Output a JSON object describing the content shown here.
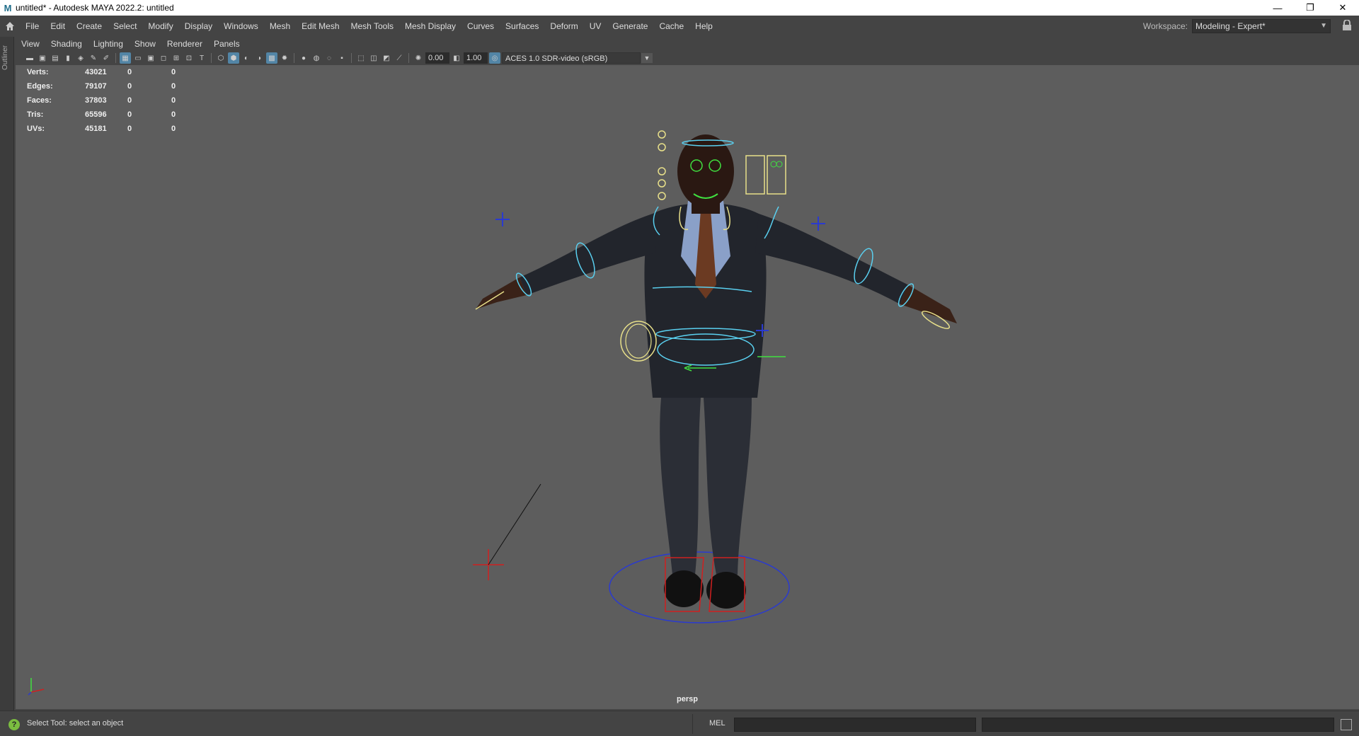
{
  "window": {
    "title": "untitled* - Autodesk MAYA 2022.2: untitled",
    "logo_letter": "M",
    "controls": {
      "minimize": "—",
      "maximize": "❐",
      "close": "✕"
    }
  },
  "menubar": {
    "items": [
      "File",
      "Edit",
      "Create",
      "Select",
      "Modify",
      "Display",
      "Windows",
      "Mesh",
      "Edit Mesh",
      "Mesh Tools",
      "Mesh Display",
      "Curves",
      "Surfaces",
      "Deform",
      "UV",
      "Generate",
      "Cache",
      "Help"
    ],
    "workspace_label": "Workspace:",
    "workspace_value": "Modeling - Expert*",
    "workspace_arrow": "▼"
  },
  "outliner": {
    "label": "Outliner"
  },
  "panel_menu": {
    "items": [
      "View",
      "Shading",
      "Lighting",
      "Show",
      "Renderer",
      "Panels"
    ]
  },
  "panel_toolbar": {
    "exposure": "0.00",
    "gamma": "1.00",
    "color_management": "ACES 1.0 SDR-video (sRGB)",
    "cm_arrow": "▼"
  },
  "hud": {
    "rows": [
      {
        "label": "Verts:",
        "v1": "43021",
        "v2": "0",
        "v3": "0"
      },
      {
        "label": "Edges:",
        "v1": "79107",
        "v2": "0",
        "v3": "0"
      },
      {
        "label": "Faces:",
        "v1": "37803",
        "v2": "0",
        "v3": "0"
      },
      {
        "label": "Tris:",
        "v1": "65596",
        "v2": "0",
        "v3": "0"
      },
      {
        "label": "UVs:",
        "v1": "45181",
        "v2": "0",
        "v3": "0"
      }
    ]
  },
  "viewport": {
    "camera": "persp"
  },
  "status": {
    "help_icon": "?",
    "help_text": "Select Tool: select an object",
    "cmd_language": "MEL"
  },
  "colors": {
    "viewport_bg": "#5d5d5d",
    "ui_bg": "#444444",
    "selection_blue": "#5285a6",
    "ctrl_yellow": "#e8e08a",
    "ctrl_cyan": "#5ad0f0",
    "ctrl_blue": "#2a3ad0",
    "ctrl_red": "#d02020",
    "ctrl_green": "#40e040"
  }
}
